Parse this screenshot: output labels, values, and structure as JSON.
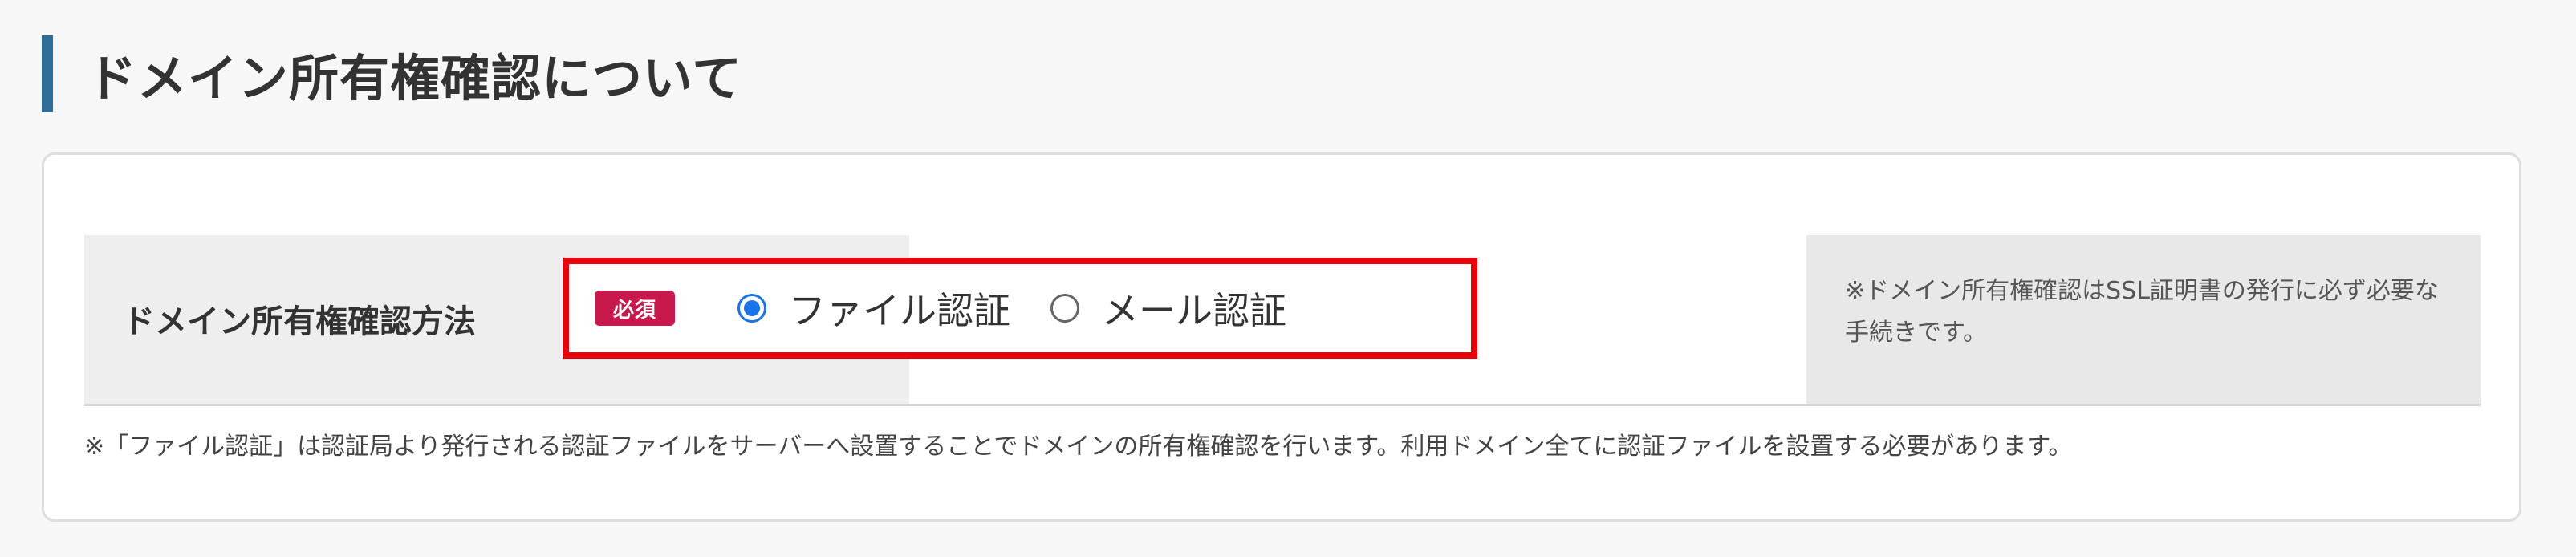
{
  "section": {
    "title": "ドメイン所有権確認について"
  },
  "form": {
    "row_label": "ドメイン所有権確認方法",
    "required_badge": "必須",
    "options": [
      {
        "label": "ファイル認証",
        "selected": true
      },
      {
        "label": "メール認証",
        "selected": false
      }
    ],
    "side_note": "※ドメイン所有権確認はSSL証明書の発行に必ず必要な手続きです。"
  },
  "footer_note": "※「ファイル認証」は認証局より発行される認証ファイルをサーバーへ設置することでドメインの所有権確認を行います。利用ドメイン全てに認証ファイルを設置する必要があります。",
  "colors": {
    "accent_bar": "#2f6d98",
    "highlight_border": "#e8000b",
    "required_badge": "#c8194d",
    "radio_selected": "#1a73e8"
  }
}
